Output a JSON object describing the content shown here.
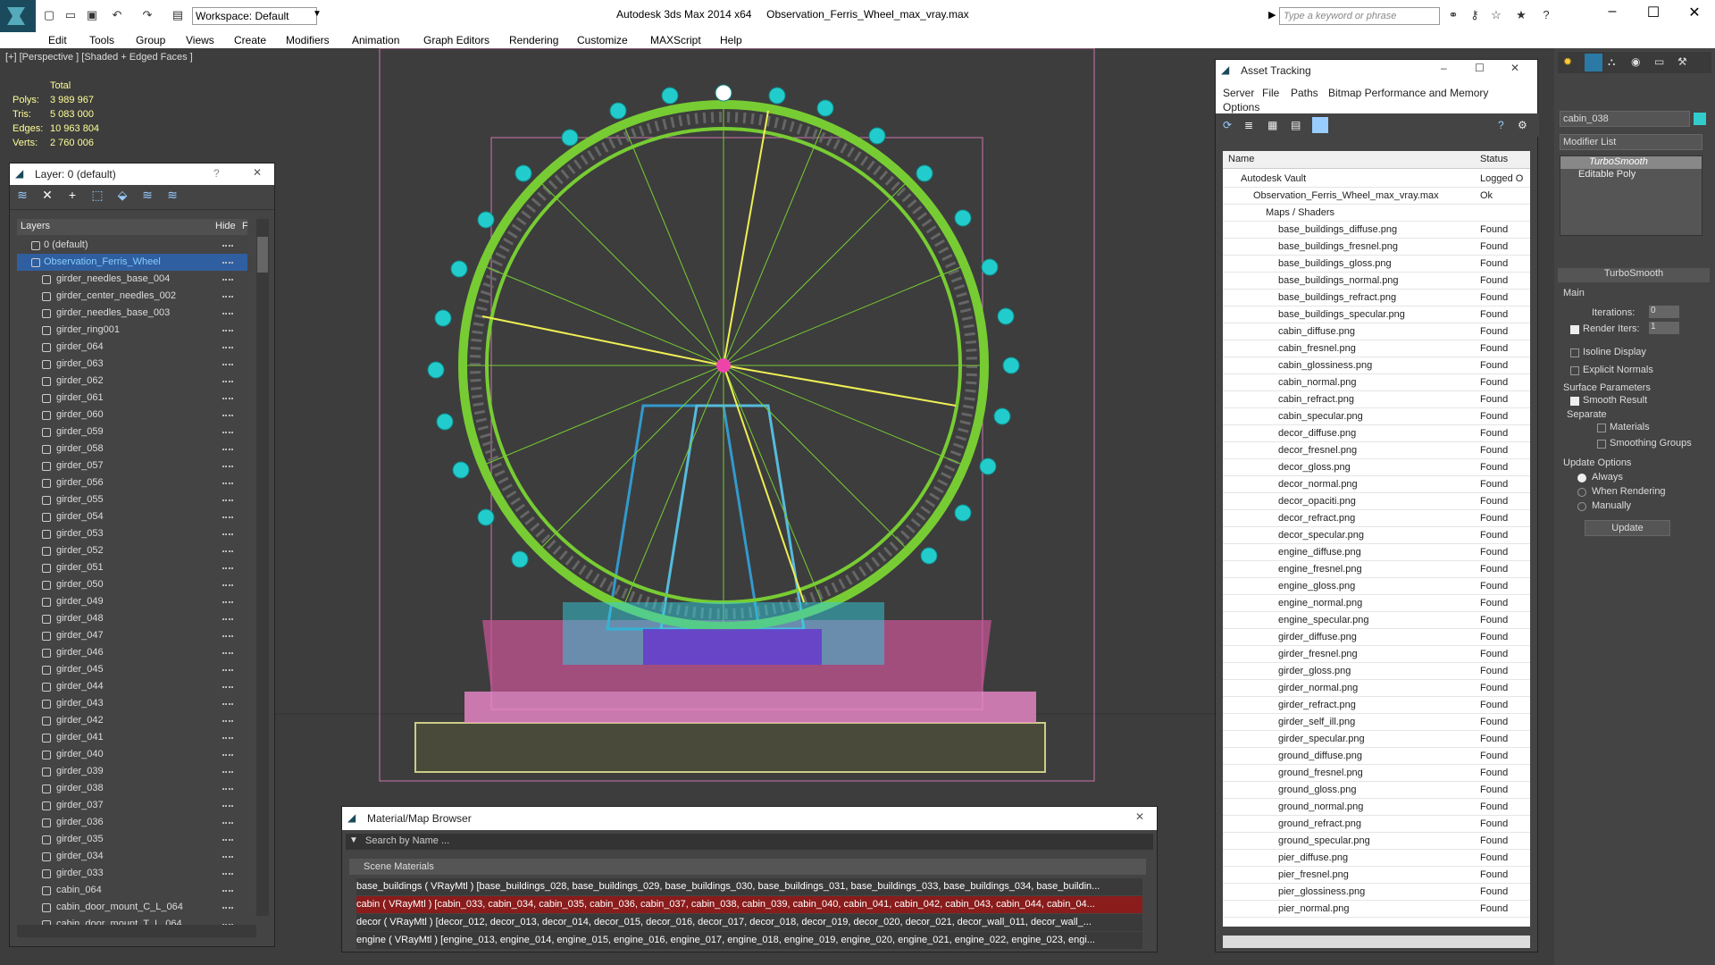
{
  "titlebar": {
    "app": "Autodesk 3ds Max  2014 x64",
    "file": "Observation_Ferris_Wheel_max_vray.max",
    "workspace": "Workspace: Default",
    "search_placeholder": "Type a keyword or phrase"
  },
  "menu": [
    "Edit",
    "Tools",
    "Group",
    "Views",
    "Create",
    "Modifiers",
    "Animation",
    "Graph Editors",
    "Rendering",
    "Customize",
    "MAXScript",
    "Help"
  ],
  "viewport": {
    "label": "[+] [Perspective ] [Shaded + Edged Faces ]"
  },
  "stats": {
    "title": "Total",
    "polys_label": "Polys:",
    "polys": "3 989 967",
    "tris_label": "Tris:",
    "tris": "5 083 000",
    "edges_label": "Edges:",
    "edges": "10 963 804",
    "verts_label": "Verts:",
    "verts": "2 760 006"
  },
  "layers": {
    "title": "Layer: 0 (default)",
    "col_layers": "Layers",
    "col_hide": "Hide",
    "col_f": "F",
    "rows": [
      "0 (default)",
      "Observation_Ferris_Wheel",
      "girder_needles_base_004",
      "girder_center_needles_002",
      "girder_needles_base_003",
      "girder_ring001",
      "girder_064",
      "girder_063",
      "girder_062",
      "girder_061",
      "girder_060",
      "girder_059",
      "girder_058",
      "girder_057",
      "girder_056",
      "girder_055",
      "girder_054",
      "girder_053",
      "girder_052",
      "girder_051",
      "girder_050",
      "girder_049",
      "girder_048",
      "girder_047",
      "girder_046",
      "girder_045",
      "girder_044",
      "girder_043",
      "girder_042",
      "girder_041",
      "girder_040",
      "girder_039",
      "girder_038",
      "girder_037",
      "girder_036",
      "girder_035",
      "girder_034",
      "girder_033",
      "cabin_064",
      "cabin_door_mount_C_L_064",
      "cabin_door_mount_T_L_064"
    ]
  },
  "asset": {
    "title": "Asset Tracking",
    "menu": [
      "Server",
      "File",
      "Paths",
      "Bitmap Performance and Memory",
      "Options"
    ],
    "col_name": "Name",
    "col_status": "Status",
    "rows": [
      {
        "n": "Autodesk Vault",
        "s": "Logged O",
        "lvl": 1
      },
      {
        "n": "Observation_Ferris_Wheel_max_vray.max",
        "s": "Ok",
        "lvl": 2
      },
      {
        "n": "Maps / Shaders",
        "s": "",
        "lvl": 3
      },
      {
        "n": "base_buildings_diffuse.png",
        "s": "Found",
        "lvl": 4
      },
      {
        "n": "base_buildings_fresnel.png",
        "s": "Found",
        "lvl": 4
      },
      {
        "n": "base_buildings_gloss.png",
        "s": "Found",
        "lvl": 4
      },
      {
        "n": "base_buildings_normal.png",
        "s": "Found",
        "lvl": 4
      },
      {
        "n": "base_buildings_refract.png",
        "s": "Found",
        "lvl": 4
      },
      {
        "n": "base_buildings_specular.png",
        "s": "Found",
        "lvl": 4
      },
      {
        "n": "cabin_diffuse.png",
        "s": "Found",
        "lvl": 4
      },
      {
        "n": "cabin_fresnel.png",
        "s": "Found",
        "lvl": 4
      },
      {
        "n": "cabin_glossiness.png",
        "s": "Found",
        "lvl": 4
      },
      {
        "n": "cabin_normal.png",
        "s": "Found",
        "lvl": 4
      },
      {
        "n": "cabin_refract.png",
        "s": "Found",
        "lvl": 4
      },
      {
        "n": "cabin_specular.png",
        "s": "Found",
        "lvl": 4
      },
      {
        "n": "decor_diffuse.png",
        "s": "Found",
        "lvl": 4
      },
      {
        "n": "decor_fresnel.png",
        "s": "Found",
        "lvl": 4
      },
      {
        "n": "decor_gloss.png",
        "s": "Found",
        "lvl": 4
      },
      {
        "n": "decor_normal.png",
        "s": "Found",
        "lvl": 4
      },
      {
        "n": "decor_opaciti.png",
        "s": "Found",
        "lvl": 4
      },
      {
        "n": "decor_refract.png",
        "s": "Found",
        "lvl": 4
      },
      {
        "n": "decor_specular.png",
        "s": "Found",
        "lvl": 4
      },
      {
        "n": "engine_diffuse.png",
        "s": "Found",
        "lvl": 4
      },
      {
        "n": "engine_fresnel.png",
        "s": "Found",
        "lvl": 4
      },
      {
        "n": "engine_gloss.png",
        "s": "Found",
        "lvl": 4
      },
      {
        "n": "engine_normal.png",
        "s": "Found",
        "lvl": 4
      },
      {
        "n": "engine_specular.png",
        "s": "Found",
        "lvl": 4
      },
      {
        "n": "girder_diffuse.png",
        "s": "Found",
        "lvl": 4
      },
      {
        "n": "girder_fresnel.png",
        "s": "Found",
        "lvl": 4
      },
      {
        "n": "girder_gloss.png",
        "s": "Found",
        "lvl": 4
      },
      {
        "n": "girder_normal.png",
        "s": "Found",
        "lvl": 4
      },
      {
        "n": "girder_refract.png",
        "s": "Found",
        "lvl": 4
      },
      {
        "n": "girder_self_ill.png",
        "s": "Found",
        "lvl": 4
      },
      {
        "n": "girder_specular.png",
        "s": "Found",
        "lvl": 4
      },
      {
        "n": "ground_diffuse.png",
        "s": "Found",
        "lvl": 4
      },
      {
        "n": "ground_fresnel.png",
        "s": "Found",
        "lvl": 4
      },
      {
        "n": "ground_gloss.png",
        "s": "Found",
        "lvl": 4
      },
      {
        "n": "ground_normal.png",
        "s": "Found",
        "lvl": 4
      },
      {
        "n": "ground_refract.png",
        "s": "Found",
        "lvl": 4
      },
      {
        "n": "ground_specular.png",
        "s": "Found",
        "lvl": 4
      },
      {
        "n": "pier_diffuse.png",
        "s": "Found",
        "lvl": 4
      },
      {
        "n": "pier_fresnel.png",
        "s": "Found",
        "lvl": 4
      },
      {
        "n": "pier_glossiness.png",
        "s": "Found",
        "lvl": 4
      },
      {
        "n": "pier_normal.png",
        "s": "Found",
        "lvl": 4
      }
    ]
  },
  "material": {
    "title": "Material/Map Browser",
    "search": "Search by Name ...",
    "group": "Scene Materials",
    "rows": [
      "base_buildings ( VRayMtl ) [base_buildings_028, base_buildings_029, base_buildings_030, base_buildings_031, base_buildings_033, base_buildings_034, base_buildin...",
      "cabin  ( VRayMtl )  [cabin_033, cabin_034, cabin_035, cabin_036, cabin_037, cabin_038, cabin_039, cabin_040, cabin_041, cabin_042, cabin_043, cabin_044, cabin_04...",
      "decor  ( VRayMtl )  [decor_012, decor_013, decor_014, decor_015, decor_016, decor_017, decor_018, decor_019, decor_020, decor_021, decor_wall_011, decor_wall_...",
      "engine  ( VRayMtl )  [engine_013, engine_014, engine_015, engine_016, engine_017, engine_018, engine_019, engine_020, engine_021, engine_022, engine_023, engi..."
    ]
  },
  "command": {
    "object_name": "cabin_038",
    "modifier_list": "Modifier List",
    "stack": [
      "TurboSmooth",
      "Editable Poly"
    ],
    "rollout": "TurboSmooth",
    "main": "Main",
    "iterations_label": "Iterations:",
    "iterations": "0",
    "render_iters_label": "Render Iters:",
    "render_iters": "1",
    "isoline": "Isoline Display",
    "explicit": "Explicit Normals",
    "surface": "Surface Parameters",
    "smooth": "Smooth Result",
    "separate": "Separate",
    "materials": "Materials",
    "smoothing": "Smoothing Groups",
    "update_opts": "Update Options",
    "always": "Always",
    "when_rendering": "When Rendering",
    "manually": "Manually",
    "update": "Update"
  }
}
